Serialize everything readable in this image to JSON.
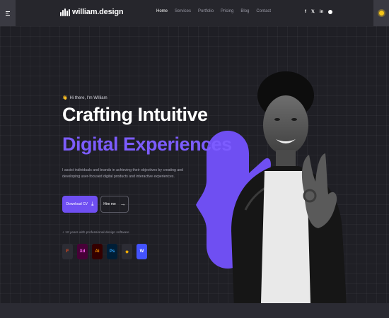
{
  "header": {
    "logo_text": "william.design",
    "nav": [
      "Home",
      "Services",
      "Portfolio",
      "Pricing",
      "Blog",
      "Contact"
    ],
    "active_nav": "Home",
    "socials": [
      {
        "icon": "facebook-icon",
        "glyph": "f"
      },
      {
        "icon": "x-icon",
        "glyph": "𝕏"
      },
      {
        "icon": "linkedin-icon",
        "glyph": "in"
      },
      {
        "icon": "github-icon",
        "glyph": "●"
      }
    ]
  },
  "hero": {
    "greeting": "Hi there, I'm William",
    "title_line1": "Crafting Intuitive",
    "title_line2": "Digital Experiences",
    "description": "I assist individuals and brands in achieving their objectives by creating and developing user-focused digital products and interactive experiences.",
    "download_cv_label": "Download CV",
    "hire_me_label": "Hire me",
    "experience_text": "+ 12 years with professional design software",
    "tools": [
      {
        "name": "figma-icon",
        "label": "F",
        "color": "#f24e1e",
        "bg": "#2a2a30"
      },
      {
        "name": "adobe-xd-icon",
        "label": "Xd",
        "color": "#ff61f6",
        "bg": "#470137"
      },
      {
        "name": "illustrator-icon",
        "label": "Ai",
        "color": "#ff9a00",
        "bg": "#330000"
      },
      {
        "name": "photoshop-icon",
        "label": "Ps",
        "color": "#31a8ff",
        "bg": "#001e36"
      },
      {
        "name": "sketch-icon",
        "label": "◆",
        "color": "#fdb300",
        "bg": "#2a2a30"
      },
      {
        "name": "webflow-icon",
        "label": "W",
        "color": "#ffffff",
        "bg": "#4353ff"
      }
    ]
  },
  "colors": {
    "accent": "#7c5cff",
    "button": "#6f4ff2",
    "background": "#1f1f25",
    "header": "#26262c"
  }
}
